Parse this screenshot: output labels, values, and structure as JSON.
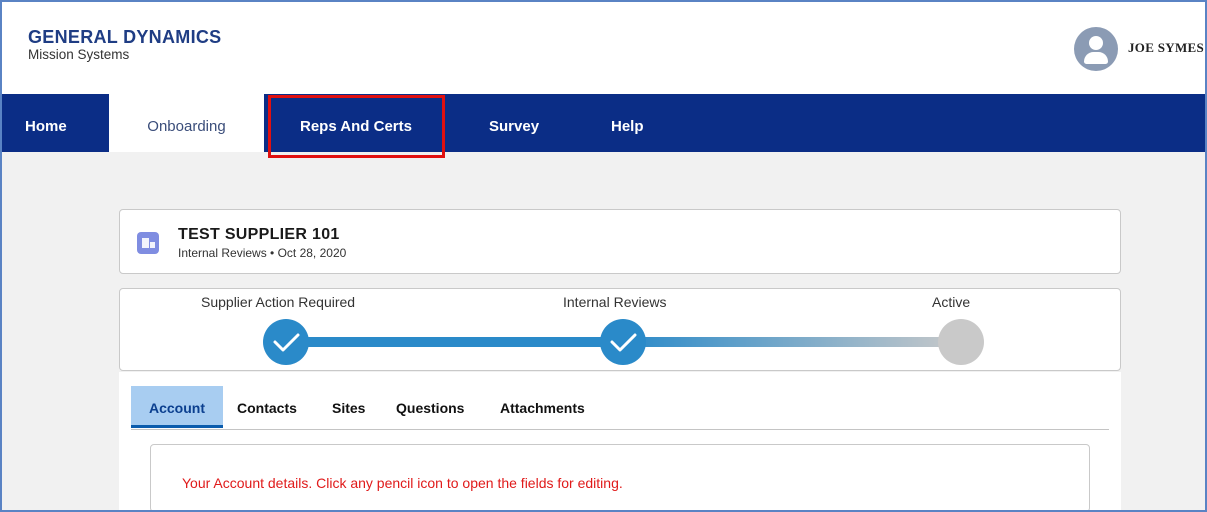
{
  "header": {
    "logo_main": "GENERAL DYNAMICS",
    "logo_sub": "Mission Systems",
    "user_name": "JOE SYMES"
  },
  "nav": {
    "items": [
      {
        "label": "Home"
      },
      {
        "label": "Onboarding"
      },
      {
        "label": "Reps And Certs"
      },
      {
        "label": "Survey"
      },
      {
        "label": "Help"
      }
    ]
  },
  "record": {
    "title": "TEST SUPPLIER 101",
    "subtitle": "Internal Reviews • Oct 28, 2020"
  },
  "path": {
    "stages": [
      {
        "label": "Supplier Action Required",
        "status": "complete"
      },
      {
        "label": "Internal Reviews",
        "status": "complete"
      },
      {
        "label": "Active",
        "status": "incomplete"
      }
    ]
  },
  "tabs": [
    {
      "label": "Account"
    },
    {
      "label": "Contacts"
    },
    {
      "label": "Sites"
    },
    {
      "label": "Questions"
    },
    {
      "label": "Attachments"
    }
  ],
  "account": {
    "hint": "Your Account details. Click any pencil icon to open the fields for editing."
  },
  "colors": {
    "nav_bg": "#0b2d86",
    "accent": "#2a8ac9",
    "highlight": "#e01010",
    "hint_text": "#e01a1a"
  }
}
